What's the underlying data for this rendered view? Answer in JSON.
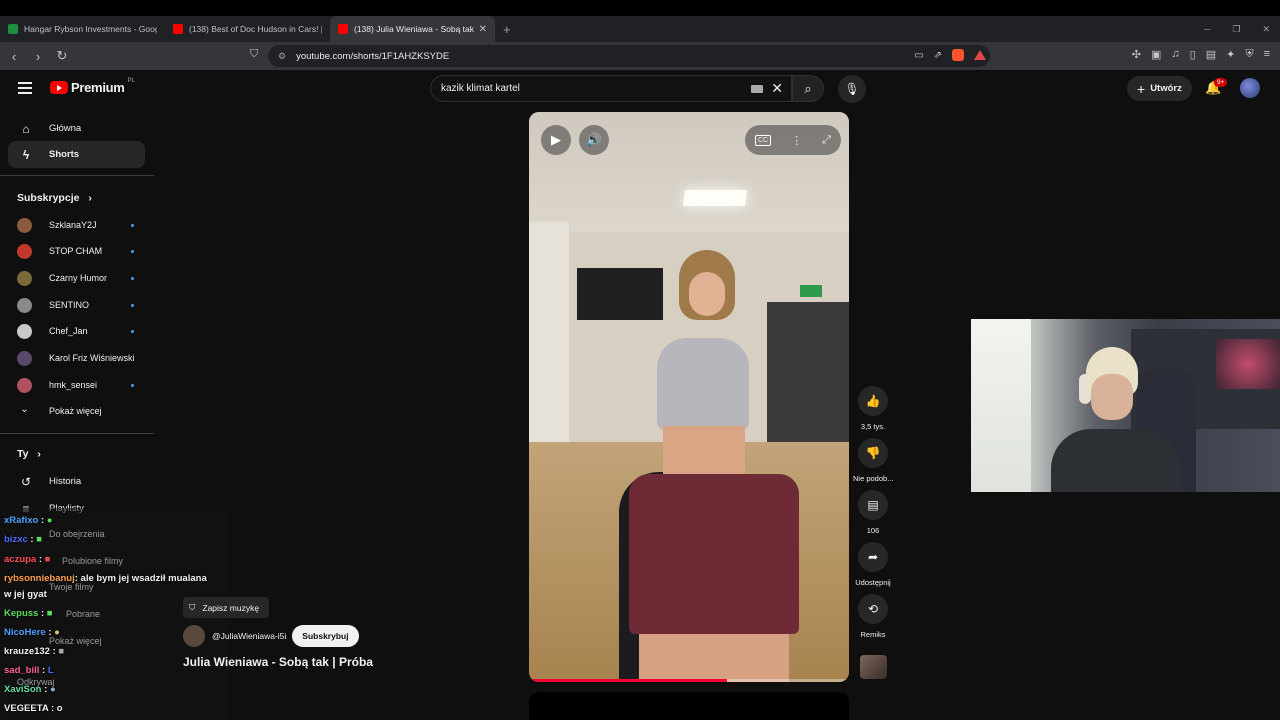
{
  "browser": {
    "tabs": [
      {
        "title": "Hangar Rybson Investments - Google",
        "color": "#1e8e3e"
      },
      {
        "title": "(138) Best of Doc Hudson in Cars! | P",
        "color": "#ff0000"
      },
      {
        "title": "(138) Julia Wieniawa - Sobą tak | P",
        "color": "#ff0000"
      }
    ],
    "url": "youtube.com/shorts/1F1AHZKSYDE"
  },
  "header": {
    "logo": "Premium",
    "region": "PL",
    "search_value": "kazik klimat kartel",
    "create_label": "Utwórz",
    "notif_badge": "9+"
  },
  "sidebar": {
    "nav": [
      {
        "label": "Główna",
        "icon": "home-icon"
      },
      {
        "label": "Shorts",
        "icon": "shorts-icon"
      }
    ],
    "subs_heading": "Subskrypcje",
    "subscriptions": [
      {
        "name": "SzklanaY2J",
        "color": "#8a5a3c"
      },
      {
        "name": "STOP CHAM",
        "color": "#c0392b"
      },
      {
        "name": "Czarny Humor",
        "color": "#7a6a3a"
      },
      {
        "name": "SENTINO",
        "color": "#8a8a8a"
      },
      {
        "name": "Chef_Jan",
        "color": "#c9c9c9"
      },
      {
        "name": "Karol Friz Wiśniewski",
        "color": "#5a4a6a"
      },
      {
        "name": "hmk_sensei",
        "color": "#b05060"
      }
    ],
    "show_more": "Pokaż więcej",
    "you_heading": "Ty",
    "you_items": [
      {
        "label": "Historia",
        "icon": "history-icon"
      },
      {
        "label": "Playlisty",
        "icon": "playlist-icon"
      }
    ],
    "ghost_items": [
      "Do obejrzenia",
      "Polubione filmy",
      "Twoje filmy",
      "Pobrane",
      "Pokaż więcej",
      "Odkrywaj"
    ]
  },
  "chat": [
    {
      "user": "xRafixo",
      "msg": ":",
      "color": "#4fa3ff"
    },
    {
      "user": "bizxc",
      "msg": ":",
      "color": "#4a6aff"
    },
    {
      "user": "aczupa",
      "msg": ":",
      "color": "#ff4f4f"
    },
    {
      "user": "rybsonniebanuj",
      "msg": ": ale bym jej wsadził mualana",
      "color": "#ff9f4f"
    },
    {
      "user": "w jej gyat",
      "msg": "",
      "color": "#ffffff"
    },
    {
      "user": "Kepuss",
      "msg": ":",
      "color": "#5fdc5f"
    },
    {
      "user": "NicoHere",
      "msg": ":",
      "color": "#4f9fff"
    },
    {
      "user": "krauze132",
      "msg": ":",
      "color": "#ffffff"
    },
    {
      "user": "sad_bill",
      "msg": ":",
      "color": "#ff5f9f"
    },
    {
      "user": "XaviSon",
      "msg": ":",
      "color": "#5fdf9f"
    },
    {
      "user": "VEGEETA",
      "msg": ": o",
      "color": "#ffffff"
    }
  ],
  "short": {
    "save_music": "Zapisz muzykę",
    "channel": "@JuliaWieniawa-i5i",
    "subscribe": "Subskrybuj",
    "title": "Julia Wieniawa - Sobą tak | Próba",
    "progress": 0.62,
    "actions": [
      {
        "label": "3,5 tys.",
        "icon": "like-icon"
      },
      {
        "label": "Nie podob...",
        "icon": "dislike-icon"
      },
      {
        "label": "106",
        "icon": "comment-icon"
      },
      {
        "label": "Udostępnij",
        "icon": "share-icon"
      },
      {
        "label": "Remiks",
        "icon": "remix-icon"
      }
    ]
  }
}
